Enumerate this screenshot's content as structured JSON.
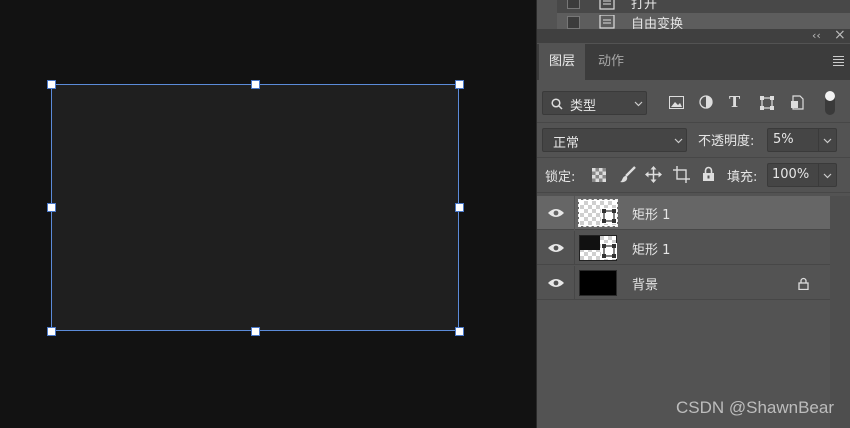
{
  "history": {
    "items": [
      {
        "label": "打开"
      },
      {
        "label": "自由变换"
      }
    ]
  },
  "panel": {
    "collapse_glyph": "‹‹",
    "close_glyph": "×",
    "tabs": [
      {
        "label": "图层"
      },
      {
        "label": "动作"
      }
    ],
    "filter": {
      "label": "类型"
    },
    "blend_mode": {
      "value": "正常"
    },
    "opacity": {
      "label": "不透明度:",
      "value": "5%"
    },
    "lock": {
      "label": "锁定:"
    },
    "fill": {
      "label": "填充:",
      "value": "100%"
    },
    "layers": [
      {
        "name": "矩形 1",
        "selected": true
      },
      {
        "name": "矩形 1",
        "selected": false
      },
      {
        "name": "背景",
        "selected": false
      }
    ]
  },
  "watermark": "CSDN @ShawnBear",
  "colors": {
    "selection": "#5b8bd9",
    "panel_bg": "#535353",
    "canvas_bg": "#121212"
  },
  "icons": [
    "search-icon",
    "image-filter-icon",
    "adjustment-filter-icon",
    "type-filter-icon",
    "shape-filter-icon",
    "smartobject-filter-icon",
    "filter-toggle-icon",
    "lock-pixels-icon",
    "lock-paint-icon",
    "lock-move-icon",
    "lock-artboard-icon",
    "lock-all-icon",
    "eye-icon",
    "lock-icon",
    "panel-menu-icon"
  ]
}
